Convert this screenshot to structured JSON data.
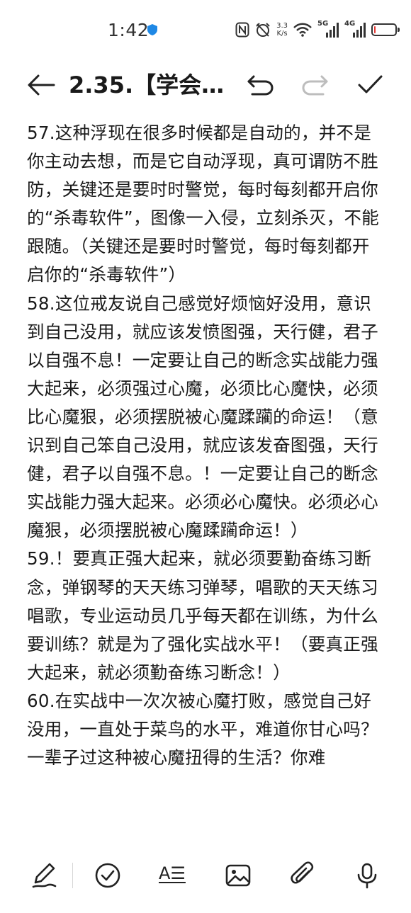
{
  "status_bar": {
    "time": "1:42",
    "net_speed_value": "3.3",
    "net_speed_unit": "K/s",
    "signal_1_tag": "5G",
    "signal_2_tag": "4G",
    "battery_level": 0.08,
    "battery_color": "#e53935",
    "shield_color": "#1e88e5"
  },
  "toolbar": {
    "back_icon": "arrow-left-icon",
    "title": "2.35.【学会…",
    "undo_icon": "undo-icon",
    "redo_icon": "redo-icon",
    "confirm_icon": "checkmark-icon"
  },
  "content": {
    "paragraphs": [
      "57.这种浮现在很多时候都是自动的，并不是你主动去想，而是它自动浮现，真可谓防不胜防，关键还是要时时警觉，每时每刻都开启你的“杀毒软件”，图像一入侵，立刻杀灭，不能跟随。（关键还是要时时警觉，每时每刻都开启你的“杀毒软件”）",
      "58.这位戒友说自己感觉好烦恼好没用，意识到自己没用，就应该发愤图强，天行健，君子以自强不息！一定要让自己的断念实战能力强大起来，必须强过心魔，必须比心魔快，必须比心魔狠，必须摆脱被心魔蹂躏的命运！（意识到自己笨自己没用，就应该发奋图强，天行健，君子以自强不息。！一定要让自己的断念实战能力强大起来。必须必心魔快。必须必心魔狠，必须摆脱被心魔蹂躏命运！）",
      "59.！要真正强大起来，就必须要勤奋练习断念，弹钢琴的天天练习弹琴，唱歌的天天练习唱歌，专业运动员几乎每天都在训练，为什么要训练？就是为了强化实战水平！（要真正强大起来，就必须勤奋练习断念！）",
      "60.在实战中一次次被心魔打败，感觉自己好没用，一直处于菜鸟的水平，难道你甘心吗？一辈子过这种被心魔扭得的生活？你难"
    ]
  },
  "bottom_bar": {
    "handwriting_icon": "pen-icon",
    "checklist_icon": "check-circle-icon",
    "text_style_label": "A☰",
    "image_icon": "image-icon",
    "attachment_icon": "paperclip-icon",
    "voice_icon": "microphone-icon"
  }
}
